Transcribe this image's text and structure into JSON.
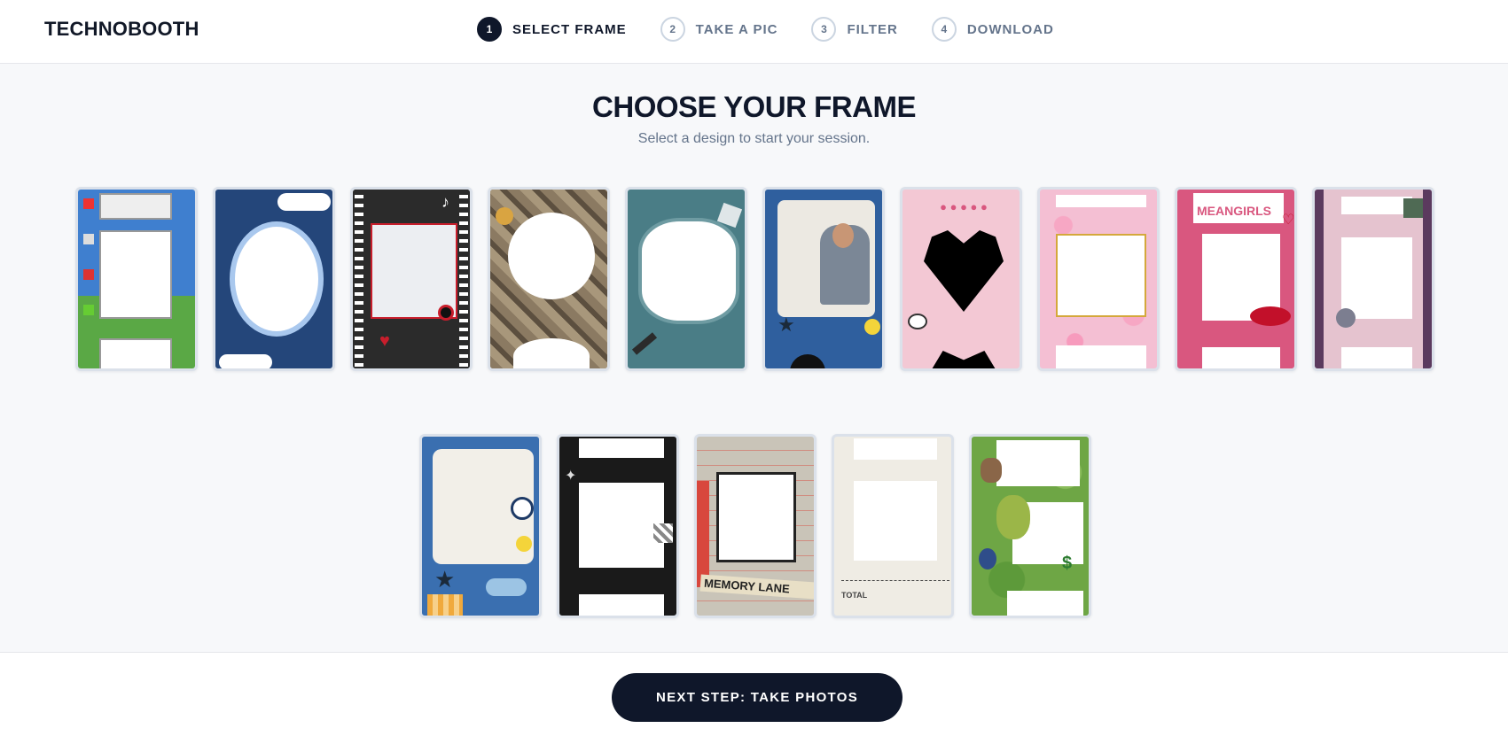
{
  "app": {
    "brand": "TECHNOBOOTH"
  },
  "steps": [
    {
      "num": "1",
      "label": "SELECT FRAME",
      "active": true
    },
    {
      "num": "2",
      "label": "TAKE A PIC",
      "active": false
    },
    {
      "num": "3",
      "label": "FILTER",
      "active": false
    },
    {
      "num": "4",
      "label": "DOWNLOAD",
      "active": false
    }
  ],
  "main": {
    "title": "CHOOSE YOUR FRAME",
    "subtitle": "Select a design to start your session."
  },
  "frames": [
    {
      "theme": "retro-desktop-windows",
      "bg": "#3f7fcf",
      "accent": "#5aa845"
    },
    {
      "theme": "blue-denim-flowers",
      "bg": "#24467a",
      "accent": "#a9c8ee"
    },
    {
      "theme": "rock-music-film-strip",
      "bg": "#2b2b2b",
      "accent": "#c81e2c"
    },
    {
      "theme": "vintage-collage",
      "bg": "#8b7a62",
      "accent": "#d9a441"
    },
    {
      "theme": "teal-doodle-wavy",
      "bg": "#4a7d86",
      "accent": "#ffffff"
    },
    {
      "theme": "denim-scrapbook-photo",
      "bg": "#2f5f9e",
      "accent": "#ece9e2"
    },
    {
      "theme": "pink-sanrio-heart",
      "bg": "#f3c8d4",
      "accent": "#000000"
    },
    {
      "theme": "pink-floral-gold",
      "bg": "#f4bfd3",
      "accent": "#d4a83b"
    },
    {
      "theme": "mean-girls-pink",
      "bg": "#d9577f",
      "accent": "#ffffff",
      "caption": "MEANGIRLS"
    },
    {
      "theme": "satin-pink-purple",
      "bg": "#e5c3cf",
      "accent": "#5b3a5e"
    },
    {
      "theme": "denim-gingham-scrapbook",
      "bg": "#3a6fb0",
      "accent": "#f2efe8"
    },
    {
      "theme": "black-film-strip",
      "bg": "#1a1a1a",
      "accent": "#ffffff"
    },
    {
      "theme": "memory-lane-collage",
      "bg": "#c9c4b8",
      "accent": "#d8473d",
      "caption": "MEMORY LANE"
    },
    {
      "theme": "receipt-paper",
      "bg": "#efece4",
      "accent": "#444444",
      "caption": "TOTAL"
    },
    {
      "theme": "shrek-swamp",
      "bg": "#6ea645",
      "accent": "#3f6b2a"
    }
  ],
  "footer": {
    "next_label": "NEXT STEP: TAKE PHOTOS"
  }
}
